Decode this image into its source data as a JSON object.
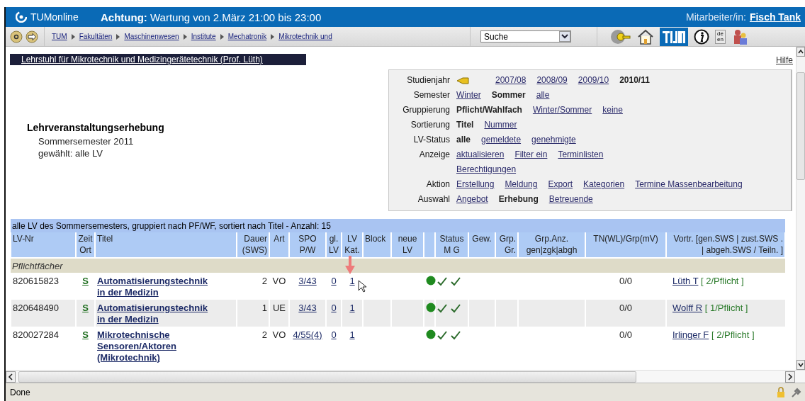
{
  "header": {
    "app_name": "TUMonline",
    "notice": "**Achtung:** Wartung von 2.März 21:00 bis 23:00",
    "user_label": "Mitarbeiter/in:",
    "user_name": "Fisch Tank"
  },
  "toolbar": {
    "breadcrumbs": [
      "TUM",
      "Fakultäten",
      "Maschinenwesen",
      "Institute",
      "Mechatronik",
      "Mikrotechnik und"
    ],
    "search": {
      "value": "Suche"
    },
    "language": [
      "de",
      "en"
    ]
  },
  "org_link": "Lehrstuhl für Mikrotechnik und Medizingerätetechnik (Prof. Lüth)",
  "help_link": "Hilfe",
  "page": {
    "title": "Lehrveranstaltungserhebung",
    "subtitle": "Sommersemester 2011",
    "selection": "gewählt: alle LV"
  },
  "filters": [
    {
      "label": "Studienjahr",
      "options": [
        {
          "kind": "back"
        },
        {
          "kind": "option",
          "text": "2007/08",
          "selected": false
        },
        {
          "kind": "option",
          "text": "2008/09",
          "selected": false
        },
        {
          "kind": "option",
          "text": "2009/10",
          "selected": false
        },
        {
          "kind": "option",
          "text": "2010/11",
          "selected": true
        }
      ]
    },
    {
      "label": "Semester",
      "options": [
        {
          "kind": "option",
          "text": "Winter",
          "selected": false
        },
        {
          "kind": "option",
          "text": "Sommer",
          "selected": true
        },
        {
          "kind": "option",
          "text": "alle",
          "selected": false
        }
      ]
    },
    {
      "label": "Gruppierung",
      "options": [
        {
          "kind": "option",
          "text": "Pflicht/Wahlfach",
          "selected": true
        },
        {
          "kind": "option",
          "text": "Winter/Sommer",
          "selected": false
        },
        {
          "kind": "option",
          "text": "keine",
          "selected": false
        }
      ]
    },
    {
      "label": "Sortierung",
      "options": [
        {
          "kind": "option",
          "text": "Titel",
          "selected": true
        },
        {
          "kind": "option",
          "text": "Nummer",
          "selected": false
        }
      ]
    },
    {
      "label": "LV-Status",
      "options": [
        {
          "kind": "option",
          "text": "alle",
          "selected": true
        },
        {
          "kind": "option",
          "text": "gemeldete",
          "selected": false
        },
        {
          "kind": "option",
          "text": "genehmigte",
          "selected": false
        }
      ]
    },
    {
      "label": "Anzeige",
      "options": [
        {
          "kind": "option",
          "text": "aktualisieren",
          "selected": false
        },
        {
          "kind": "option",
          "text": "Filter ein",
          "selected": false
        },
        {
          "kind": "option",
          "text": "Terminlisten",
          "selected": false
        },
        {
          "kind": "option",
          "text": "Berechtigungen",
          "selected": false,
          "wrap": true
        }
      ]
    },
    {
      "label": "Aktion",
      "options": [
        {
          "kind": "option",
          "text": "Erstellung",
          "selected": false
        },
        {
          "kind": "option",
          "text": "Meldung",
          "selected": false
        },
        {
          "kind": "option",
          "text": "Export",
          "selected": false
        },
        {
          "kind": "option",
          "text": "Kategorien",
          "selected": false
        },
        {
          "kind": "option",
          "text": "Termine Massenbearbeitung",
          "selected": false
        }
      ]
    },
    {
      "label": "Auswahl",
      "options": [
        {
          "kind": "option",
          "text": "Angebot",
          "selected": false
        },
        {
          "kind": "option",
          "text": "Erhebung",
          "selected": true
        },
        {
          "kind": "option",
          "text": "Betreuende",
          "selected": false
        }
      ]
    }
  ],
  "table": {
    "caption": "alle LV des Sommersemesters, gruppiert nach PF/WF, sortiert nach Titel - Anzahl: 15",
    "columns": [
      "LV-Nr",
      "Zeit\nOrt",
      "Titel",
      "Dauer\n(SWS)",
      "Art",
      "SPO\nP/W",
      "gl.\nLV",
      "LV\nKat.",
      "Block",
      "neue\nLV",
      null,
      "Status\nM   G",
      "Gew.",
      "Grp.\nGr.",
      "Grp.Anz.\ngen|zgk|abgh",
      "TN(WL)/Grp(mV)",
      "Vortr. [gen.SWS | zust.SWS .\n| abgeh.SWS / Teiln. ]"
    ],
    "group": "Pflichtfächer",
    "rows": [
      {
        "lv_nr": "820615823",
        "zeit_ort": "S",
        "title": "Automatisierungstechnik in der Medizin",
        "dauer": "2",
        "art": "VO",
        "spo": "3/43",
        "gl_lv": "0",
        "lv_kat": "1",
        "released": true,
        "m_ok": true,
        "g_ok": true,
        "tn": "0/0",
        "lecturer": "Lüth T",
        "assignment": "[ 2/Pflicht ]"
      },
      {
        "lv_nr": "820648490",
        "zeit_ort": "S",
        "title": "Automatisierungstechnik in der Medizin",
        "dauer": "1",
        "art": "UE",
        "spo": "3/43",
        "gl_lv": "0",
        "lv_kat": "1",
        "released": true,
        "m_ok": true,
        "g_ok": true,
        "tn": "0/0",
        "lecturer": "Wolff R",
        "assignment": "[ 1/Pflicht ]"
      },
      {
        "lv_nr": "820027284",
        "zeit_ort": "S",
        "title": "Mikrotechnische Sensoren/Aktoren (Mikrotechnik)",
        "dauer": "2",
        "art": "VO",
        "spo": "4/55(4)",
        "gl_lv": "0",
        "lv_kat": "1",
        "released": true,
        "m_ok": true,
        "g_ok": true,
        "tn": "0/0",
        "lecturer": "Irlinger F",
        "assignment": "[ 2/Pflicht ]"
      }
    ]
  },
  "status_bar": {
    "text": "Done"
  }
}
